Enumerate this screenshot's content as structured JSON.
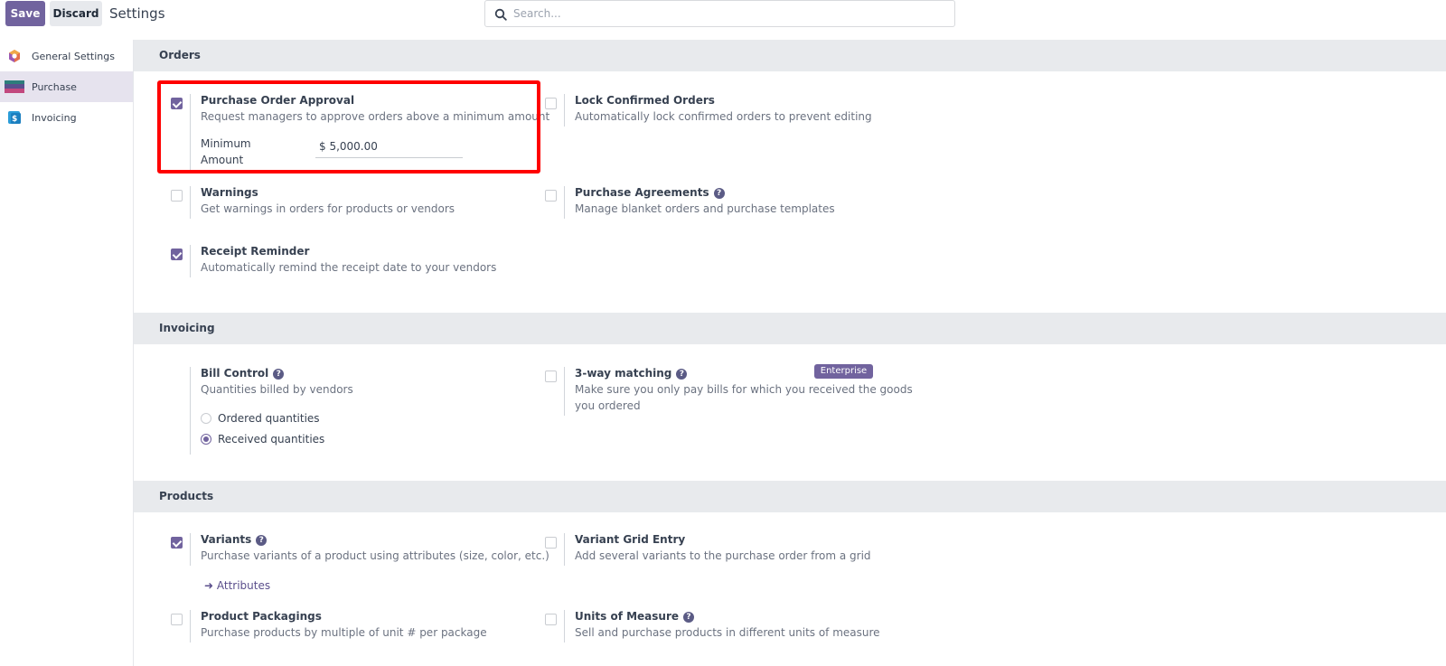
{
  "toolbar": {
    "save_label": "Save",
    "discard_label": "Discard",
    "title": "Settings"
  },
  "search": {
    "placeholder": "Search..."
  },
  "sidebar": {
    "items": [
      {
        "label": "General Settings",
        "icon": "odoo-logo-icon",
        "active": false
      },
      {
        "label": "Purchase",
        "icon": "purchase-app-icon",
        "active": true
      },
      {
        "label": "Invoicing",
        "icon": "invoicing-app-icon",
        "active": false
      }
    ]
  },
  "sections": {
    "orders": {
      "heading": "Orders",
      "po_approval": {
        "title": "Purchase Order Approval",
        "desc": "Request managers to approve orders above a minimum amount",
        "checked": true,
        "min_label": "Minimum Amount",
        "min_value": "$ 5,000.00"
      },
      "lock_orders": {
        "title": "Lock Confirmed Orders",
        "desc": "Automatically lock confirmed orders to prevent editing",
        "checked": false
      },
      "warnings": {
        "title": "Warnings",
        "desc": "Get warnings in orders for products or vendors",
        "checked": false
      },
      "agreements": {
        "title": "Purchase Agreements",
        "desc": "Manage blanket orders and purchase templates",
        "checked": false
      },
      "receipt_reminder": {
        "title": "Receipt Reminder",
        "desc": "Automatically remind the receipt date to your vendors",
        "checked": true
      }
    },
    "invoicing": {
      "heading": "Invoicing",
      "bill_control": {
        "title": "Bill Control",
        "desc": "Quantities billed by vendors",
        "options": [
          "Ordered quantities",
          "Received quantities"
        ],
        "selected": "Received quantities"
      },
      "three_way": {
        "title": "3-way matching",
        "desc_line1": "Make sure you only pay bills for which you received the goods",
        "desc_line2": "you ordered",
        "badge": "Enterprise",
        "checked": false
      }
    },
    "products": {
      "heading": "Products",
      "variants": {
        "title": "Variants",
        "desc": "Purchase variants of a product using attributes (size, color, etc.)",
        "checked": true,
        "link": "Attributes"
      },
      "variant_grid": {
        "title": "Variant Grid Entry",
        "desc": "Add several variants to the purchase order from a grid",
        "checked": false
      },
      "packagings": {
        "title": "Product Packagings",
        "desc": "Purchase products by multiple of unit # per package",
        "checked": false
      },
      "uom": {
        "title": "Units of Measure",
        "desc": "Sell and purchase products in different units of measure",
        "checked": false
      }
    }
  },
  "colors": {
    "accent": "#71639e",
    "highlight": "#ff0000",
    "section_bg": "#e8eaed"
  }
}
